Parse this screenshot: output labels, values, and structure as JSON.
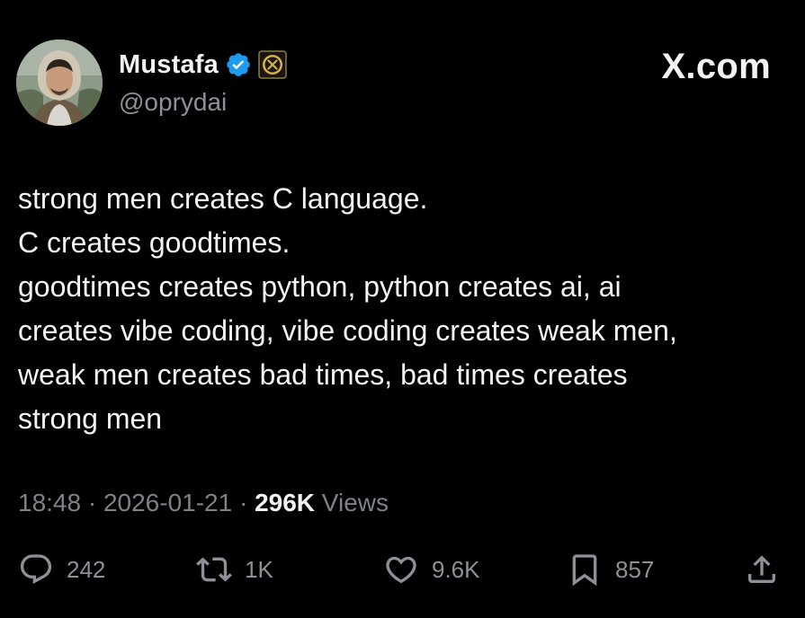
{
  "author": {
    "display_name": "Mustafa",
    "handle": "@oprydai",
    "verified_icon": "verified-badge-icon",
    "affiliation_icon": "affiliation-badge-icon",
    "verified_color": "#1d9bf0",
    "affiliation_color": "#d4b24c"
  },
  "brand": {
    "label": "X.com"
  },
  "tweet": {
    "lines": [
      "strong men creates C language.",
      "C creates goodtimes.",
      "goodtimes creates python, python creates ai, ai",
      "creates vibe coding, vibe coding creates weak men,",
      "weak men creates bad times, bad times creates",
      "strong men"
    ]
  },
  "meta": {
    "time": "18:48",
    "separator": " · ",
    "date": "2026-01-21",
    "views_count": "296K",
    "views_label": " Views"
  },
  "actions": {
    "reply": {
      "icon": "reply-icon",
      "count": "242"
    },
    "repost": {
      "icon": "repost-icon",
      "count": "1K"
    },
    "like": {
      "icon": "heart-icon",
      "count": "9.6K"
    },
    "bookmark": {
      "icon": "bookmark-icon",
      "count": "857"
    },
    "share": {
      "icon": "share-icon"
    }
  },
  "colors": {
    "background": "#000000",
    "text": "#f2f3f4",
    "muted": "#8b9196"
  }
}
